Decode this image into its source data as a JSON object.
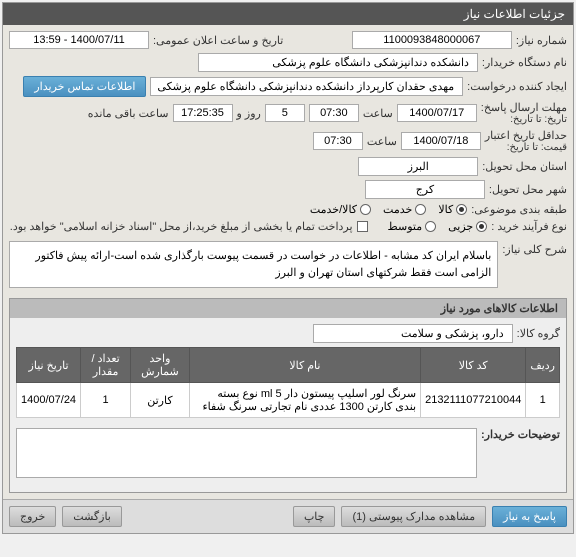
{
  "panel_title": "جزئیات اطلاعات نیاز",
  "fields": {
    "need_number_label": "شماره نیاز:",
    "need_number": "1100093848000067",
    "buyer_org_label": "نام دستگاه خریدار:",
    "buyer_org": "دانشکده دندانپزشکی دانشگاه علوم پزشکی",
    "announce_datetime_label": "تاریخ و ساعت اعلان عمومی:",
    "announce_datetime": "1400/07/11 - 13:59",
    "requester_label": "ایجاد کننده درخواست:",
    "requester": "مهدی حقدان کارپرداز دانشکده دندانپزشکی دانشگاه علوم پزشکی",
    "contact_btn": "اطلاعات تماس خریدار",
    "deadline_label": "مهلت ارسال پاسخ:",
    "deadline_until_label": "تاریخ:  تا تاریخ:",
    "deadline_date": "1400/07/17",
    "time_label": "ساعت",
    "deadline_time": "07:30",
    "days_count": "5",
    "days_and_label": "روز و",
    "countdown": "17:25:35",
    "countdown_suffix": "ساعت باقی مانده",
    "validity_label": "حداقل تاریخ اعتبار",
    "validity_sub": "قیمت:  تا تاریخ:",
    "validity_date": "1400/07/18",
    "validity_time": "07:30",
    "province_label": "استان محل تحویل:",
    "province": "البرز",
    "city_label": "شهر محل تحویل:",
    "city": "کرج",
    "category_label": "طبقه بندی موضوعی:",
    "cat_goods": "کالا",
    "cat_service": "خدمت",
    "cat_goods_service": "کالا/خدمت",
    "process_label": "نوع فرآیند خرید :",
    "proc_partial": "جزیی",
    "proc_medium": "متوسط",
    "payment_note": "پرداخت تمام یا بخشی از مبلغ خرید،از محل \"اسناد خزانه اسلامی\" خواهد بود.",
    "desc_label": "شرح کلی نیاز:",
    "desc_text": "باسلام ایران کد مشابه - اطلاعات در خواست در قسمت پیوست بارگذاری شده است-ارائه پیش فاکتور الزامی است فقط شرکتهای استان تهران و البرز"
  },
  "items_section": {
    "header": "اطلاعات کالاهای مورد نیاز",
    "group_label": "گروه کالا:",
    "group_value": "دارو، پزشکی و سلامت",
    "columns": {
      "row": "ردیف",
      "code": "کد کالا",
      "name": "نام کالا",
      "unit": "واحد شمارش",
      "qty": "تعداد / مقدار",
      "date": "تاریخ نیاز"
    },
    "rows": [
      {
        "idx": "1",
        "code": "2132111077210044",
        "name": "سرنگ لور اسلیپ پیستون دار ml 5 نوع بسته بندی کارتن 1300 عددی نام تجارتی سرنگ شفاء",
        "unit": "کارتن",
        "qty": "1",
        "date": "1400/07/24"
      }
    ]
  },
  "buyer_notes_label": "توضیحات خریدار:",
  "footer": {
    "reply": "پاسخ به نیاز",
    "attachments": "مشاهده مدارک پیوستی (1)",
    "print": "چاپ",
    "back": "بازگشت",
    "exit": "خروج"
  }
}
